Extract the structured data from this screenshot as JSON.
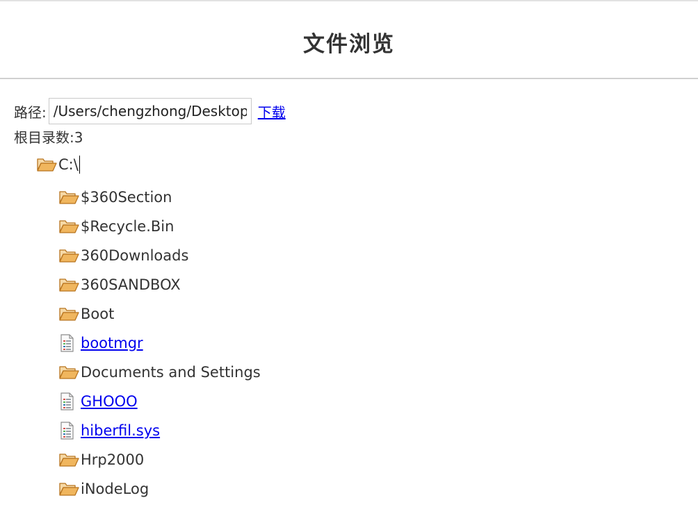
{
  "header": {
    "title": "文件浏览"
  },
  "path": {
    "label": "路径:",
    "value": "/Users/chengzhong/Desktop",
    "download_label": "下载"
  },
  "root_count": "根目录数:3",
  "tree": {
    "root": {
      "label": "C:\\",
      "icon": "folder-open-icon"
    },
    "items": [
      {
        "label": "$360Section",
        "type": "folder",
        "icon": "folder-open-icon"
      },
      {
        "label": "$Recycle.Bin",
        "type": "folder",
        "icon": "folder-open-icon"
      },
      {
        "label": "360Downloads",
        "type": "folder",
        "icon": "folder-open-icon"
      },
      {
        "label": "360SANDBOX",
        "type": "folder",
        "icon": "folder-open-icon"
      },
      {
        "label": "Boot",
        "type": "folder",
        "icon": "folder-open-icon"
      },
      {
        "label": "bootmgr",
        "type": "file",
        "icon": "file-icon"
      },
      {
        "label": "Documents and Settings",
        "type": "folder",
        "icon": "folder-open-icon"
      },
      {
        "label": "GHOOO",
        "type": "file",
        "icon": "file-icon"
      },
      {
        "label": "hiberfil.sys",
        "type": "file",
        "icon": "file-icon"
      },
      {
        "label": "Hrp2000",
        "type": "folder",
        "icon": "folder-open-icon"
      },
      {
        "label": "iNodeLog",
        "type": "folder",
        "icon": "folder-open-icon"
      }
    ]
  },
  "colors": {
    "link": "#0000ee",
    "folder": "#e8a94a",
    "text": "#333333"
  }
}
